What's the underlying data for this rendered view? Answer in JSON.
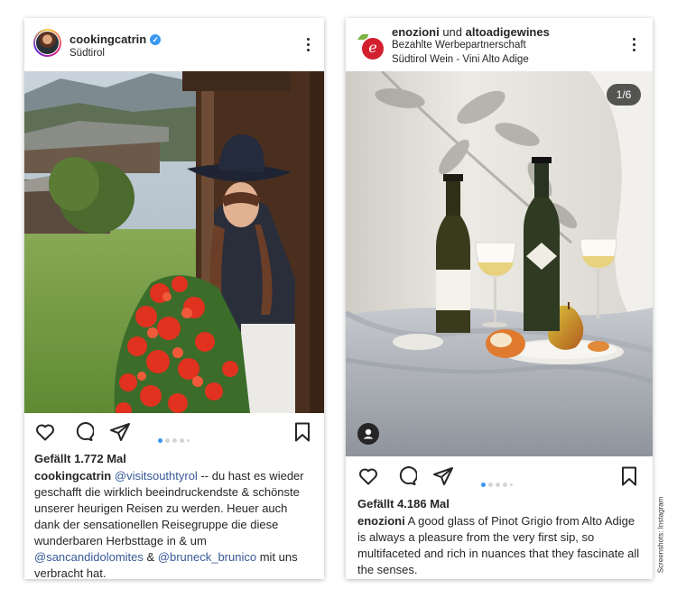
{
  "post1": {
    "username": "cookingcatrin",
    "location": "Südtirol",
    "likes": "Gefällt 1.772 Mal",
    "caption": {
      "user": "cookingcatrin",
      "mention1": "@visitsouthtyrol",
      "text1": " -- du hast es wieder geschafft die wirklich beeindruckendste & schönste unserer heurigen Reisen zu werden. Heuer auch dank der sensationellen Reisegruppe die diese wunderbaren Herbsttage in & um ",
      "mention2": "@sancandidolomites",
      "text2": " & ",
      "mention3": "@bruneck_brunico",
      "text3": "  mit uns verbracht hat."
    }
  },
  "post2": {
    "username1": "enozioni",
    "connector": " und ",
    "username2": "altoadigewines",
    "sponsored": "Bezahlte Werbepartnerschaft",
    "location": "Südtirol Wein - Vini Alto Adige",
    "counter": "1/6",
    "likes": "Gefällt 4.186 Mal",
    "caption": {
      "user": "enozioni",
      "text": " A good glass of Pinot Grigio from Alto Adige is always a pleasure from the very first sip, so multifaceted and rich in nuances that they fascinate all the senses."
    }
  },
  "credit": "Screenshots: Instagram",
  "icons": [
    "verified-badge-icon",
    "more-options-icon",
    "heart-icon",
    "comment-icon",
    "share-icon",
    "bookmark-icon",
    "user-tag-icon"
  ],
  "colors": {
    "accent_blue": "#3897f0",
    "mention": "#385898",
    "text": "#262626"
  }
}
